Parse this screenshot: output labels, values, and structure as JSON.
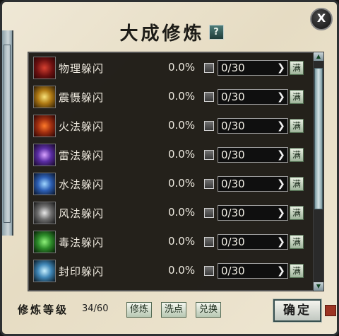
{
  "window": {
    "title": "大成修炼",
    "help_icon": "?",
    "close_icon": "X"
  },
  "skills": [
    {
      "name": "物理躲闪",
      "percent": "0.0%",
      "count": "0/30",
      "max_label": "满",
      "icon": "physical-dodge-icon"
    },
    {
      "name": "震慑躲闪",
      "percent": "0.0%",
      "count": "0/30",
      "max_label": "满",
      "icon": "shock-dodge-icon"
    },
    {
      "name": "火法躲闪",
      "percent": "0.0%",
      "count": "0/30",
      "max_label": "满",
      "icon": "fire-dodge-icon"
    },
    {
      "name": "雷法躲闪",
      "percent": "0.0%",
      "count": "0/30",
      "max_label": "满",
      "icon": "thunder-dodge-icon"
    },
    {
      "name": "水法躲闪",
      "percent": "0.0%",
      "count": "0/30",
      "max_label": "满",
      "icon": "water-dodge-icon"
    },
    {
      "name": "风法躲闪",
      "percent": "0.0%",
      "count": "0/30",
      "max_label": "满",
      "icon": "wind-dodge-icon"
    },
    {
      "name": "毒法躲闪",
      "percent": "0.0%",
      "count": "0/30",
      "max_label": "满",
      "icon": "poison-dodge-icon"
    },
    {
      "name": "封印躲闪",
      "percent": "0.0%",
      "count": "0/30",
      "max_label": "满",
      "icon": "seal-dodge-icon"
    }
  ],
  "footer": {
    "level_label": "修炼等级",
    "level_value": "34/60",
    "train_button": "修炼",
    "reset_button": "洗点",
    "exchange_button": "兑换",
    "confirm_button": "确定"
  }
}
